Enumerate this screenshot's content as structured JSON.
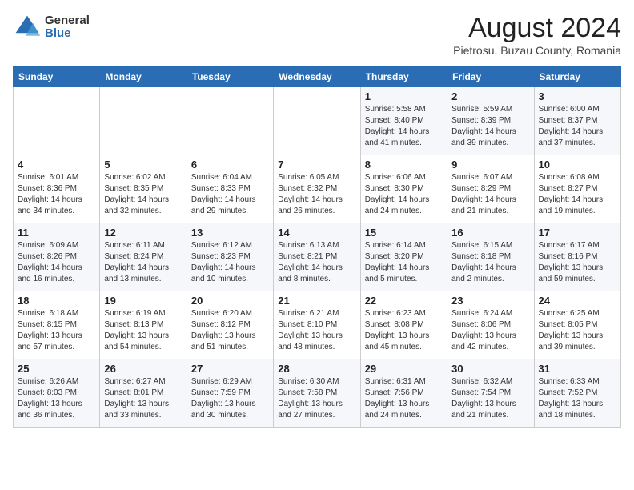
{
  "logo": {
    "general": "General",
    "blue": "Blue"
  },
  "title": "August 2024",
  "subtitle": "Pietrosu, Buzau County, Romania",
  "days_of_week": [
    "Sunday",
    "Monday",
    "Tuesday",
    "Wednesday",
    "Thursday",
    "Friday",
    "Saturday"
  ],
  "weeks": [
    [
      {
        "day": "",
        "info": ""
      },
      {
        "day": "",
        "info": ""
      },
      {
        "day": "",
        "info": ""
      },
      {
        "day": "",
        "info": ""
      },
      {
        "day": "1",
        "info": "Sunrise: 5:58 AM\nSunset: 8:40 PM\nDaylight: 14 hours and 41 minutes."
      },
      {
        "day": "2",
        "info": "Sunrise: 5:59 AM\nSunset: 8:39 PM\nDaylight: 14 hours and 39 minutes."
      },
      {
        "day": "3",
        "info": "Sunrise: 6:00 AM\nSunset: 8:37 PM\nDaylight: 14 hours and 37 minutes."
      }
    ],
    [
      {
        "day": "4",
        "info": "Sunrise: 6:01 AM\nSunset: 8:36 PM\nDaylight: 14 hours and 34 minutes."
      },
      {
        "day": "5",
        "info": "Sunrise: 6:02 AM\nSunset: 8:35 PM\nDaylight: 14 hours and 32 minutes."
      },
      {
        "day": "6",
        "info": "Sunrise: 6:04 AM\nSunset: 8:33 PM\nDaylight: 14 hours and 29 minutes."
      },
      {
        "day": "7",
        "info": "Sunrise: 6:05 AM\nSunset: 8:32 PM\nDaylight: 14 hours and 26 minutes."
      },
      {
        "day": "8",
        "info": "Sunrise: 6:06 AM\nSunset: 8:30 PM\nDaylight: 14 hours and 24 minutes."
      },
      {
        "day": "9",
        "info": "Sunrise: 6:07 AM\nSunset: 8:29 PM\nDaylight: 14 hours and 21 minutes."
      },
      {
        "day": "10",
        "info": "Sunrise: 6:08 AM\nSunset: 8:27 PM\nDaylight: 14 hours and 19 minutes."
      }
    ],
    [
      {
        "day": "11",
        "info": "Sunrise: 6:09 AM\nSunset: 8:26 PM\nDaylight: 14 hours and 16 minutes."
      },
      {
        "day": "12",
        "info": "Sunrise: 6:11 AM\nSunset: 8:24 PM\nDaylight: 14 hours and 13 minutes."
      },
      {
        "day": "13",
        "info": "Sunrise: 6:12 AM\nSunset: 8:23 PM\nDaylight: 14 hours and 10 minutes."
      },
      {
        "day": "14",
        "info": "Sunrise: 6:13 AM\nSunset: 8:21 PM\nDaylight: 14 hours and 8 minutes."
      },
      {
        "day": "15",
        "info": "Sunrise: 6:14 AM\nSunset: 8:20 PM\nDaylight: 14 hours and 5 minutes."
      },
      {
        "day": "16",
        "info": "Sunrise: 6:15 AM\nSunset: 8:18 PM\nDaylight: 14 hours and 2 minutes."
      },
      {
        "day": "17",
        "info": "Sunrise: 6:17 AM\nSunset: 8:16 PM\nDaylight: 13 hours and 59 minutes."
      }
    ],
    [
      {
        "day": "18",
        "info": "Sunrise: 6:18 AM\nSunset: 8:15 PM\nDaylight: 13 hours and 57 minutes."
      },
      {
        "day": "19",
        "info": "Sunrise: 6:19 AM\nSunset: 8:13 PM\nDaylight: 13 hours and 54 minutes."
      },
      {
        "day": "20",
        "info": "Sunrise: 6:20 AM\nSunset: 8:12 PM\nDaylight: 13 hours and 51 minutes."
      },
      {
        "day": "21",
        "info": "Sunrise: 6:21 AM\nSunset: 8:10 PM\nDaylight: 13 hours and 48 minutes."
      },
      {
        "day": "22",
        "info": "Sunrise: 6:23 AM\nSunset: 8:08 PM\nDaylight: 13 hours and 45 minutes."
      },
      {
        "day": "23",
        "info": "Sunrise: 6:24 AM\nSunset: 8:06 PM\nDaylight: 13 hours and 42 minutes."
      },
      {
        "day": "24",
        "info": "Sunrise: 6:25 AM\nSunset: 8:05 PM\nDaylight: 13 hours and 39 minutes."
      }
    ],
    [
      {
        "day": "25",
        "info": "Sunrise: 6:26 AM\nSunset: 8:03 PM\nDaylight: 13 hours and 36 minutes."
      },
      {
        "day": "26",
        "info": "Sunrise: 6:27 AM\nSunset: 8:01 PM\nDaylight: 13 hours and 33 minutes."
      },
      {
        "day": "27",
        "info": "Sunrise: 6:29 AM\nSunset: 7:59 PM\nDaylight: 13 hours and 30 minutes."
      },
      {
        "day": "28",
        "info": "Sunrise: 6:30 AM\nSunset: 7:58 PM\nDaylight: 13 hours and 27 minutes."
      },
      {
        "day": "29",
        "info": "Sunrise: 6:31 AM\nSunset: 7:56 PM\nDaylight: 13 hours and 24 minutes."
      },
      {
        "day": "30",
        "info": "Sunrise: 6:32 AM\nSunset: 7:54 PM\nDaylight: 13 hours and 21 minutes."
      },
      {
        "day": "31",
        "info": "Sunrise: 6:33 AM\nSunset: 7:52 PM\nDaylight: 13 hours and 18 minutes."
      }
    ]
  ]
}
